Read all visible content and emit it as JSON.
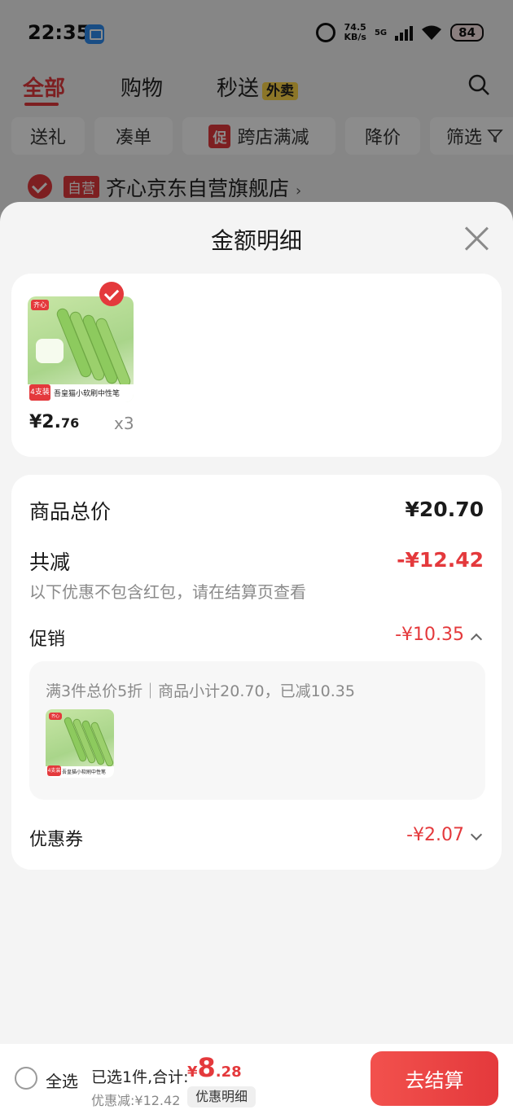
{
  "status_bar": {
    "time": "22:35",
    "net_speed_value": "74.5",
    "net_speed_unit": "KB/s",
    "network": "5G",
    "battery": "84"
  },
  "top_tabs": {
    "all": "全部",
    "shopping": "购物",
    "delivery": "秒送",
    "takeout_badge": "外卖"
  },
  "filters": {
    "gift": "送礼",
    "bundle": "凑单",
    "promo_tag": "促",
    "cross_store": "跨店满减",
    "price_drop": "降价",
    "filter": "筛选"
  },
  "shop": {
    "badge": "自营",
    "name": "齐心京东自营旗舰店"
  },
  "sheet": {
    "title": "金额明细"
  },
  "product": {
    "brand_mark": "齐心",
    "image_count": "4支装",
    "image_name": "吾皇猫小软刷中性笔",
    "unit_price_int": "¥2.",
    "unit_price_dec": "76",
    "quantity": "x3"
  },
  "breakdown": {
    "total_label": "商品总价",
    "total_value": "¥20.70",
    "reduction_label": "共减",
    "reduction_value": "-¥12.42",
    "note": "以下优惠不包含红包，请在结算页查看",
    "promo_label": "促销",
    "promo_value": "-¥10.35",
    "promo_desc": "满3件总价5折｜商品小计20.70，已减10.35",
    "coupon_label": "优惠券",
    "coupon_value": "-¥2.07"
  },
  "bottom_bar": {
    "select_all": "全选",
    "selected_summary": "已选1件,合计:",
    "total_currency": "¥",
    "total_int": "8",
    "total_dec": ".28",
    "discount_note": "优惠减:¥12.42",
    "detail_button": "优惠明细",
    "checkout_button": "去结算"
  }
}
